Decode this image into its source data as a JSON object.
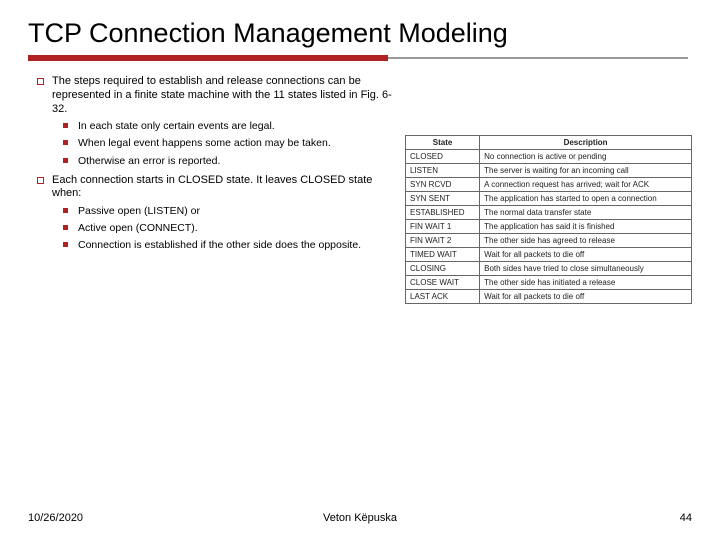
{
  "title": "TCP Connection Management Modeling",
  "bullets": [
    {
      "level": 1,
      "text": "The steps required to establish and release connections can be represented in a finite state machine with the 11 states listed in Fig. 6-32.",
      "sub": [
        {
          "text": "In each state only certain events are legal."
        },
        {
          "text": "When legal event happens some action may be taken."
        },
        {
          "text": "Otherwise an error is reported."
        }
      ]
    },
    {
      "level": 1,
      "text": "Each connection starts in CLOSED state. It leaves CLOSED state when:",
      "sub": [
        {
          "text": "Passive open (LISTEN) or"
        },
        {
          "text": "Active open (CONNECT)."
        },
        {
          "text": "Connection is established if the other side does the opposite."
        }
      ]
    }
  ],
  "table": {
    "headers": [
      "State",
      "Description"
    ],
    "rows": [
      [
        "CLOSED",
        "No connection is active or pending"
      ],
      [
        "LISTEN",
        "The server is waiting for an incoming call"
      ],
      [
        "SYN RCVD",
        "A connection request has arrived; wait for ACK"
      ],
      [
        "SYN SENT",
        "The application has started to open a connection"
      ],
      [
        "ESTABLISHED",
        "The normal data transfer state"
      ],
      [
        "FIN WAIT 1",
        "The application has said it is finished"
      ],
      [
        "FIN WAIT 2",
        "The other side has agreed to release"
      ],
      [
        "TIMED WAIT",
        "Wait for all packets to die off"
      ],
      [
        "CLOSING",
        "Both sides have tried to close simultaneously"
      ],
      [
        "CLOSE WAIT",
        "The other side has initiated a release"
      ],
      [
        "LAST ACK",
        "Wait for all packets to die off"
      ]
    ]
  },
  "footer": {
    "date": "10/26/2020",
    "author": "Veton Këpuska",
    "page": "44"
  }
}
